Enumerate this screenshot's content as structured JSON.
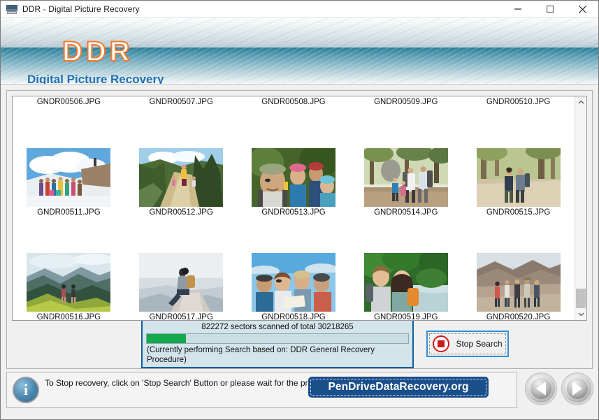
{
  "window": {
    "title": "DDR - Digital Picture Recovery",
    "icon": "app-scanner-icon",
    "controls": {
      "minimize": "minimize-icon",
      "maximize": "maximize-icon",
      "close": "close-icon"
    }
  },
  "banner": {
    "logo": "DDR",
    "subtitle": "Digital Picture Recovery"
  },
  "filelist": {
    "rows": [
      {
        "partial": true,
        "cells": [
          {
            "name": "GNDR00506.JPG",
            "thumb": "none"
          },
          {
            "name": "GNDR00507.JPG",
            "thumb": "none"
          },
          {
            "name": "GNDR00508.JPG",
            "thumb": "none"
          },
          {
            "name": "GNDR00509.JPG",
            "thumb": "none"
          },
          {
            "name": "GNDR00510.JPG",
            "thumb": "none"
          }
        ]
      },
      {
        "partial": false,
        "cells": [
          {
            "name": "GNDR00511.JPG",
            "thumb": "group-on-snow"
          },
          {
            "name": "GNDR00512.JPG",
            "thumb": "hiker-trail"
          },
          {
            "name": "GNDR00513.JPG",
            "thumb": "hikers-closeup"
          },
          {
            "name": "GNDR00514.JPG",
            "thumb": "family-forest"
          },
          {
            "name": "GNDR00515.JPG",
            "thumb": "couple-path"
          }
        ]
      },
      {
        "partial": false,
        "cells": [
          {
            "name": "GNDR00516.JPG",
            "thumb": "green-ridge"
          },
          {
            "name": "GNDR00517.JPG",
            "thumb": "sitting-rock"
          },
          {
            "name": "GNDR00518.JPG",
            "thumb": "group-map"
          },
          {
            "name": "GNDR00519.JPG",
            "thumb": "couple-river"
          },
          {
            "name": "GNDR00520.JPG",
            "thumb": "group-desert"
          }
        ]
      }
    ],
    "scrollbar": {
      "up": "chevron-up-icon",
      "down": "chevron-down-icon",
      "thumb_position": "bottom"
    }
  },
  "progress": {
    "status": "822272 sectors scanned of total 30218265",
    "sectors_scanned": 822272,
    "sectors_total": 30218265,
    "percent": 15,
    "note": "(Currently performing Search based on:  DDR General Recovery Procedure)",
    "fill_color": "#14a94c",
    "border_color": "#0f5f9e"
  },
  "stop_button": {
    "label": "Stop Search",
    "icon": "stop-circle-icon",
    "icon_color": "#cc1b1b",
    "focus_border_color": "#2f8ed6"
  },
  "info": {
    "icon": "info-icon",
    "glyph": "i",
    "text": "To Stop recovery, click on 'Stop Search' Button or please wait for the process to be completed."
  },
  "brand": {
    "label": "PenDriveDataRecovery.org",
    "background": "#1b4f8a"
  },
  "nav": {
    "back": {
      "name": "back-button",
      "icon": "triangle-left-icon"
    },
    "next": {
      "name": "next-button",
      "icon": "triangle-right-icon"
    }
  }
}
